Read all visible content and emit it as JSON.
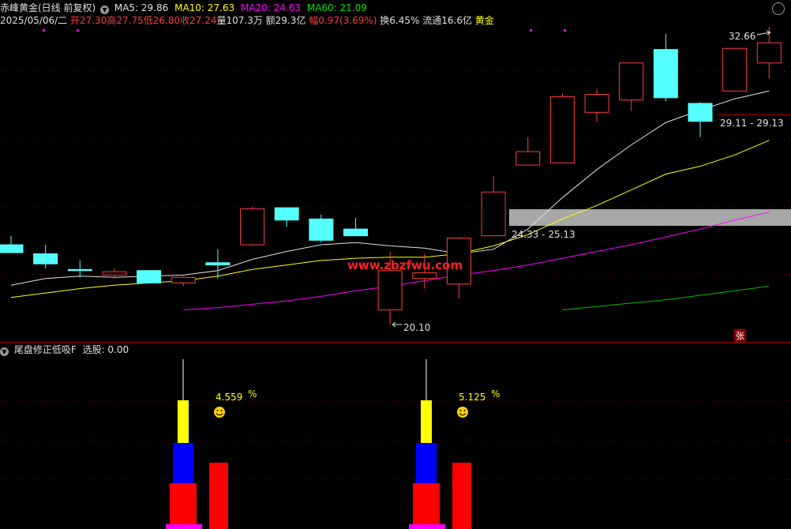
{
  "header": {
    "title": "赤峰黄金(日线 前复权)",
    "ma5": "MA5: 29.86",
    "ma10": "MA10: 27.63",
    "ma20": "MA20: 24.63",
    "ma60": "MA60: 21.09",
    "date": "2025/05/06/二",
    "open": "开27.30",
    "high": "高27.75",
    "low": "低26.80",
    "close": "收27.24",
    "volume": "量107.3万",
    "amount": "额29.3亿",
    "change": "幅0.97(3.69%)",
    "turnover": "换6.45%",
    "float_cap": "流通16.6亿",
    "sector": "黄金"
  },
  "watermark": "www.zbzfwu.com",
  "annotations": {
    "high_price": "32.66",
    "low_price": "20.10",
    "gap_upper": "29.11 - 29.13",
    "gap_lower": "24.33 - 25.13",
    "zhang_badge": "张"
  },
  "indicator": {
    "title": "尾盘修正低吸F",
    "select_label": "选股: 0.00",
    "signal1_pct": "4.559",
    "signal2_pct": "5.125",
    "pct_sign": "%"
  },
  "colors": {
    "bull": "#ff3c3c",
    "bear": "#54ffff",
    "ma5": "#e0e0e0",
    "ma10": "#ffff00",
    "ma20": "#ff00ff",
    "ma60": "#00c000",
    "gap_band": "#a8a8a8",
    "grid": "#7a0000"
  },
  "chart_data": {
    "type": "candlestick",
    "price_range": [
      19.5,
      33.5
    ],
    "candles": [
      {
        "open": 23.65,
        "close": 23.3,
        "high": 24.05,
        "low": 23.3
      },
      {
        "open": 23.25,
        "close": 22.8,
        "high": 23.65,
        "low": 22.6
      },
      {
        "open": 22.55,
        "close": 22.5,
        "high": 22.95,
        "low": 22.2
      },
      {
        "open": 22.3,
        "close": 22.45,
        "high": 22.6,
        "low": 22.15
      },
      {
        "open": 22.5,
        "close": 21.95,
        "high": 22.5,
        "low": 21.95
      },
      {
        "open": 21.95,
        "close": 22.2,
        "high": 22.25,
        "low": 21.8
      },
      {
        "open": 22.85,
        "close": 22.75,
        "high": 23.45,
        "low": 22.15
      },
      {
        "open": 23.65,
        "close": 25.25,
        "high": 25.35,
        "low": 23.6
      },
      {
        "open": 25.3,
        "close": 24.75,
        "high": 25.3,
        "low": 24.45
      },
      {
        "open": 24.8,
        "close": 23.85,
        "high": 25.0,
        "low": 23.75
      },
      {
        "open": 24.35,
        "close": 24.05,
        "high": 24.85,
        "low": 24.05
      },
      {
        "open": 20.75,
        "close": 22.5,
        "high": 23.35,
        "low": 20.1
      },
      {
        "open": 22.15,
        "close": 22.4,
        "high": 23.25,
        "low": 21.7
      },
      {
        "open": 21.9,
        "close": 23.95,
        "high": 24.0,
        "low": 21.25
      },
      {
        "open": 24.05,
        "close": 26.0,
        "high": 26.7,
        "low": 24.05
      },
      {
        "open": 27.2,
        "close": 27.8,
        "high": 28.45,
        "low": 27.2
      },
      {
        "open": 27.3,
        "close": 30.25,
        "high": 30.4,
        "low": 27.3
      },
      {
        "open": 29.55,
        "close": 30.35,
        "high": 30.6,
        "low": 29.1
      },
      {
        "open": 30.1,
        "close": 31.75,
        "high": 31.75,
        "low": 29.6
      },
      {
        "open": 32.35,
        "close": 30.2,
        "high": 33.05,
        "low": 30.05
      },
      {
        "open": 29.95,
        "close": 29.15,
        "high": 30.0,
        "low": 28.45
      },
      {
        "open": 30.5,
        "close": 32.4,
        "high": 32.4,
        "low": 30.5
      },
      {
        "open": 31.75,
        "close": 32.65,
        "high": 33.35,
        "low": 31.05
      }
    ],
    "ma5": [
      21.85,
      22.15,
      22.25,
      22.2,
      22.25,
      22.3,
      22.5,
      23.0,
      23.35,
      23.65,
      23.75,
      23.6,
      23.5,
      23.25,
      23.45,
      24.35,
      25.75,
      27.0,
      28.1,
      29.1,
      29.65,
      30.15,
      30.5
    ],
    "ma10": [
      21.3,
      21.5,
      21.7,
      21.85,
      21.95,
      22.05,
      22.25,
      22.55,
      22.75,
      22.95,
      23.05,
      23.1,
      23.1,
      23.25,
      23.6,
      24.1,
      24.8,
      25.4,
      26.1,
      26.8,
      27.15,
      27.65,
      28.3
    ],
    "ma20": [
      20.75,
      20.85,
      21.0,
      21.15,
      21.35,
      21.6,
      21.8,
      22.05,
      22.3,
      22.5,
      22.75,
      23.05,
      23.35,
      23.65,
      24.0,
      24.35,
      24.75,
      25.1
    ],
    "ma60": [
      20.75,
      20.9,
      21.05,
      21.2,
      21.4,
      21.6,
      21.8
    ]
  }
}
